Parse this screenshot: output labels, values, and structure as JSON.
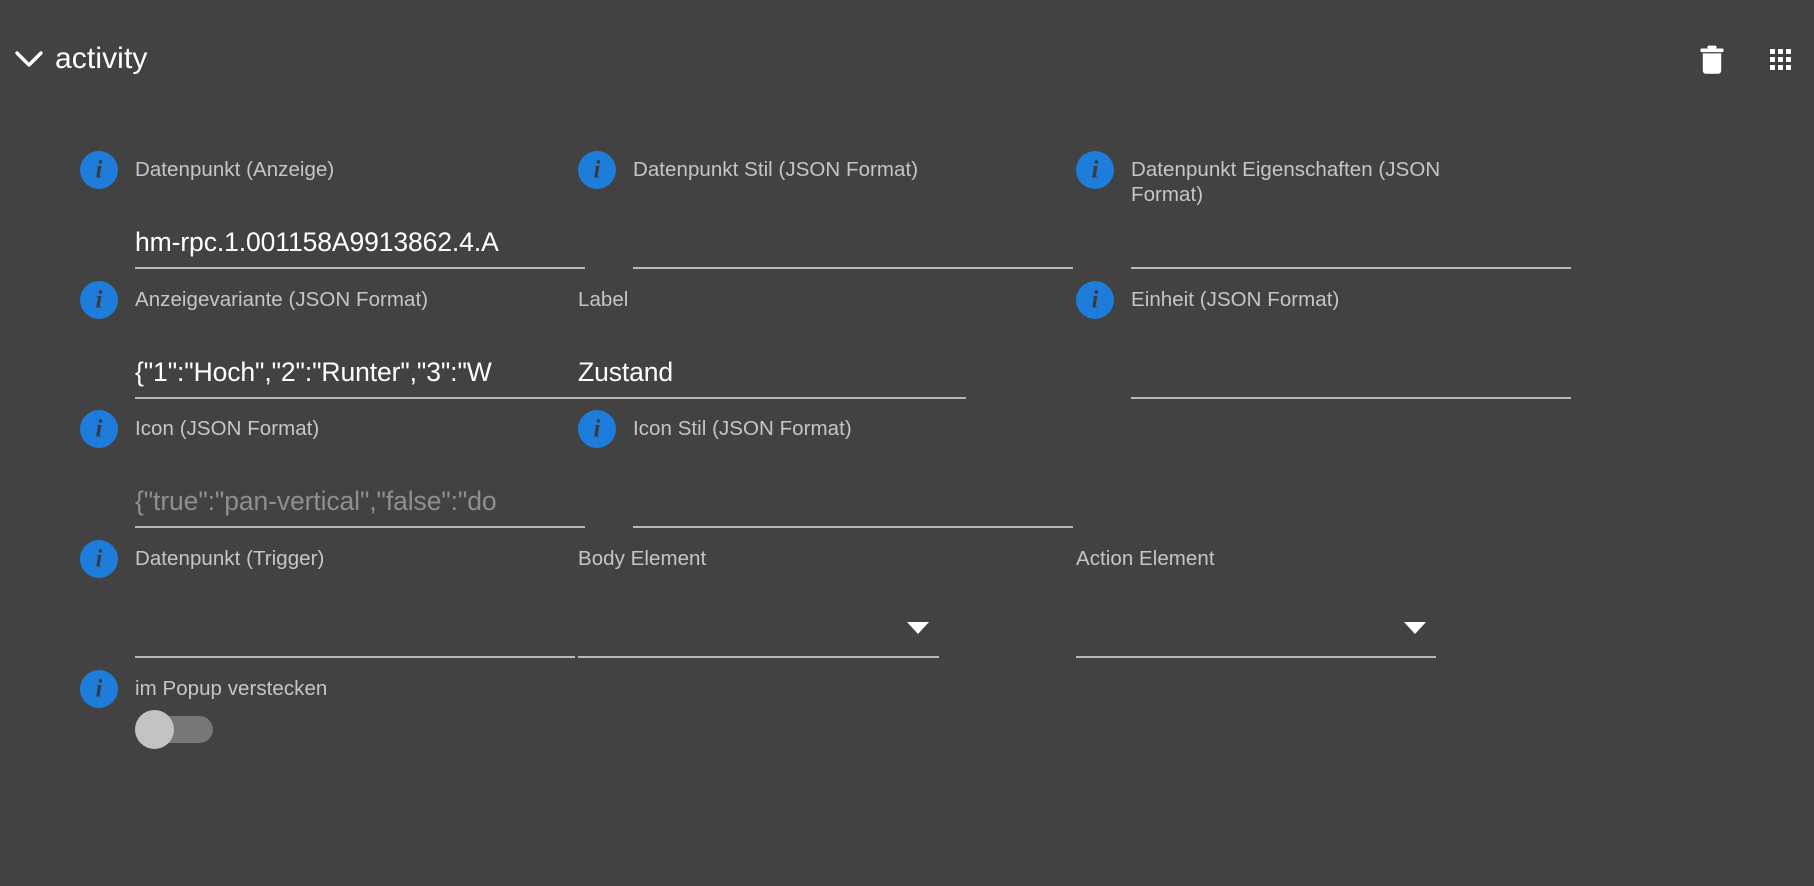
{
  "panel": {
    "title": "activity",
    "expand_icon": "chevron-down-icon",
    "actions": [
      {
        "name": "delete-button",
        "icon": "trash-icon",
        "label": ""
      },
      {
        "name": "drag-handle",
        "icon": "grid-dots-icon",
        "label": ""
      }
    ]
  },
  "colors": {
    "background": "#424242",
    "info_badge": "#1e7ddb",
    "label_text": "#c6c6c6",
    "value_text": "#ffffff",
    "placeholder_text": "#8f8f8f",
    "underline": "#b8b8b8",
    "page_background": "#ffffff"
  },
  "fields": {
    "datenpunkt_anzeige": {
      "label": "Datenpunkt (Anzeige)",
      "value": "hm-rpc.1.001158A9913862.4.A",
      "placeholder": "",
      "has_info": true
    },
    "datenpunkt_stil": {
      "label": "Datenpunkt Stil (JSON Format)",
      "value": "",
      "placeholder": "",
      "has_info": true
    },
    "datenpunkt_eigenschaften": {
      "label": "Datenpunkt Eigenschaften (JSON Format)",
      "value": "",
      "placeholder": "",
      "has_info": true
    },
    "anzeigevariante": {
      "label": "Anzeigevariante (JSON Format)",
      "value": "{\"1\":\"Hoch\",\"2\":\"Runter\",\"3\":\"W",
      "placeholder": "",
      "has_info": true
    },
    "label_field": {
      "label": "Label",
      "value": "Zustand",
      "placeholder": "",
      "has_info": false
    },
    "einheit": {
      "label": "Einheit (JSON Format)",
      "value": "",
      "placeholder": "",
      "has_info": true
    },
    "icon_json": {
      "label": "Icon (JSON Format)",
      "value": "",
      "placeholder": "{\"true\":\"pan-vertical\",\"false\":\"do",
      "has_info": true
    },
    "icon_stil": {
      "label": "Icon Stil (JSON Format)",
      "value": "",
      "placeholder": "",
      "has_info": true
    },
    "datenpunkt_trigger": {
      "label": "Datenpunkt (Trigger)",
      "value": "",
      "placeholder": "",
      "has_info": true
    },
    "body_element": {
      "label": "Body Element",
      "value": "",
      "placeholder": "",
      "has_info": false,
      "control": "select"
    },
    "action_element": {
      "label": "Action Element",
      "value": "",
      "placeholder": "",
      "has_info": false,
      "control": "select"
    },
    "im_popup_verstecken": {
      "label": "im Popup verstecken",
      "value": "off",
      "has_info": true,
      "control": "toggle"
    }
  },
  "icons": {
    "info": "i",
    "chevron_down": "chevron-down-icon",
    "trash": "trash-icon",
    "grid": "grid-dots-icon",
    "caret_down": "caret-down-icon"
  }
}
